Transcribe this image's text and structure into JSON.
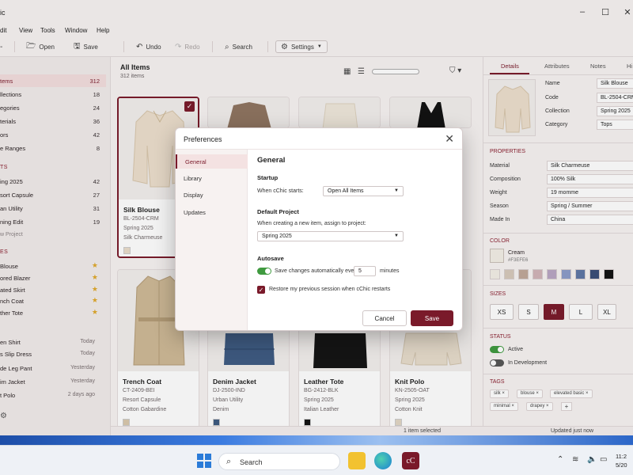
{
  "window": {
    "title": "ic"
  },
  "menu": [
    "dit",
    "View",
    "Tools",
    "Window",
    "Help"
  ],
  "toolbar": {
    "open": "Open",
    "save": "Save",
    "undo": "Undo",
    "redo": "Redo",
    "search": "Search",
    "settings": "Settings"
  },
  "sidebar": {
    "library": [
      {
        "label": "tems",
        "count": "312"
      },
      {
        "label": "llections",
        "count": "18"
      },
      {
        "label": "egories",
        "count": "24"
      },
      {
        "label": "terials",
        "count": "36"
      },
      {
        "label": "ors",
        "count": "42"
      },
      {
        "label": "e Ranges",
        "count": "8"
      }
    ],
    "collections_head": "TS",
    "collections": [
      {
        "label": "ing 2025",
        "count": "42"
      },
      {
        "label": "sort Capsule",
        "count": "27"
      },
      {
        "label": "an Utility",
        "count": "31"
      },
      {
        "label": "ning Edit",
        "count": "19"
      }
    ],
    "new_project": "w Project",
    "favorites_head": "ES",
    "favorites": [
      "Blouse",
      "ored Blazer",
      "ated Skirt",
      "nch Coat",
      "ther Tote"
    ],
    "recent": [
      {
        "label": "en Shirt",
        "time": "Today"
      },
      {
        "label": "s Slip Dress",
        "time": "Today"
      },
      {
        "label": "de Leg Pant",
        "time": "Yesterday"
      },
      {
        "label": "im Jacket",
        "time": "Yesterday"
      },
      {
        "label": "t Polo",
        "time": "2 days ago"
      }
    ]
  },
  "main": {
    "title": "All Items",
    "count": "312 items",
    "cards": [
      {
        "name": "Silk Blouse",
        "code": "BL-2504-CRM",
        "collection": "Spring 2025",
        "material": "Silk Charmeuse",
        "swatch": "#e9dcc9"
      },
      {
        "name": "Trench Coat",
        "code": "CT-2409-BEI",
        "collection": "Resort Capsule",
        "material": "Cotton Gabardine",
        "swatch": "#d9c8ad"
      },
      {
        "name": "Denim Jacket",
        "code": "DJ-2500-IND",
        "collection": "Urban Utility",
        "material": "Denim",
        "swatch": "#3d5a80"
      },
      {
        "name": "Leather Tote",
        "code": "BG-2412-BLK",
        "collection": "Spring 2025",
        "material": "Italian Leather",
        "swatch": "#111111"
      },
      {
        "name": "Knit Polo",
        "code": "KN-2505-OAT",
        "collection": "Spring 2025",
        "material": "Cotton Knit",
        "swatch": "#e2d6c4"
      }
    ]
  },
  "status": {
    "selected": "1 item selected",
    "updated": "Updated just now"
  },
  "details": {
    "tabs": [
      "Details",
      "Attributes",
      "Notes",
      "Hi"
    ],
    "name_k": "Name",
    "name_v": "Silk Blouse",
    "code_k": "Code",
    "code_v": "BL-2504-CRM",
    "collection_k": "Collection",
    "collection_v": "Spring 2025",
    "category_k": "Category",
    "category_v": "Tops",
    "properties_head": "PROPERTIES",
    "props": [
      {
        "k": "Material",
        "v": "Silk Charmeuse"
      },
      {
        "k": "Composition",
        "v": "100% Silk"
      },
      {
        "k": "Weight",
        "v": "19 momme"
      },
      {
        "k": "Season",
        "v": "Spring / Summer"
      },
      {
        "k": "Made In",
        "v": "China"
      }
    ],
    "color_head": "COLOR",
    "color_name": "Cream",
    "color_hex": "#F3EFE6",
    "palette": [
      "#f3efe6",
      "#d7c9bb",
      "#c1a89a",
      "#d2b4b8",
      "#b9a6c4",
      "#8c9cc9",
      "#5f78a6",
      "#3a4d78",
      "#111111"
    ],
    "sizes_head": "SIZES",
    "sizes": [
      "XS",
      "S",
      "M",
      "L",
      "XL"
    ],
    "status_head": "STATUS",
    "active": "Active",
    "in_dev": "In Development",
    "tags_head": "TAGS",
    "tags": [
      "silk",
      "blouse",
      "elevated basic",
      "minimal",
      "drapey"
    ]
  },
  "modal": {
    "title": "Preferences",
    "nav": [
      "General",
      "Library",
      "Display",
      "Updates"
    ],
    "heading": "General",
    "startup_head": "Startup",
    "startup_label": "When cChic starts:",
    "startup_value": "Open All Items",
    "project_head": "Default Project",
    "project_label": "When creating a new item, assign to project:",
    "project_value": "Spring 2025",
    "autosave_head": "Autosave",
    "autosave_label": "Save changes automatically every",
    "autosave_minutes": "5",
    "autosave_unit": "minutes",
    "restore_label": "Restore my previous session when cChic restarts",
    "cancel": "Cancel",
    "save": "Save"
  },
  "taskbar": {
    "search": "Search",
    "app_label": "cC",
    "time": "11:2",
    "date": "5/20"
  }
}
